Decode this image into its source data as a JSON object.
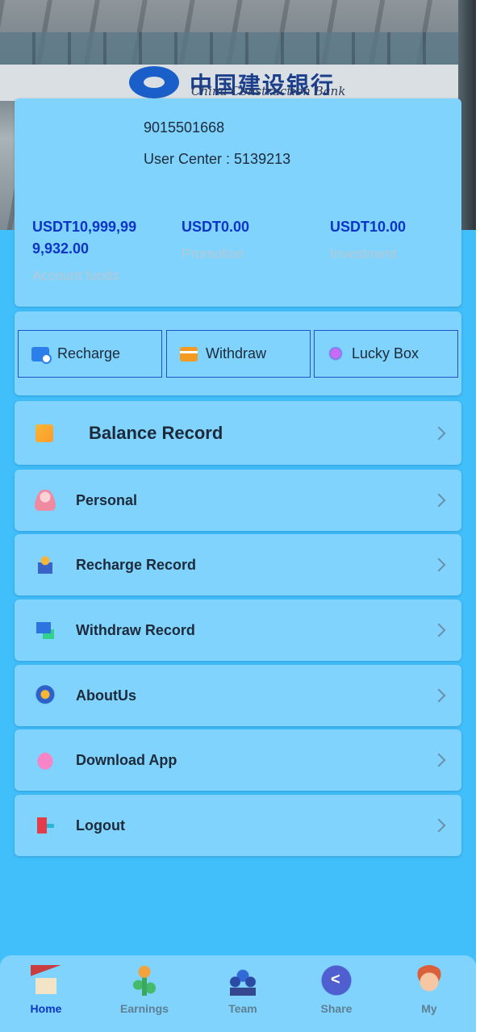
{
  "hero": {
    "bank_name_cn": "中国建设银行",
    "bank_name_en": "China Construction Bank"
  },
  "user": {
    "phone": "9015501668",
    "user_center": "User Center : 5139213"
  },
  "stats": [
    {
      "value": "USDT10,999,999,932.00",
      "label": "Account funds"
    },
    {
      "value": "USDT0.00",
      "label": "Promotion"
    },
    {
      "value": "USDT10.00",
      "label": "Investment"
    }
  ],
  "actions": [
    {
      "label": "Recharge",
      "icon": "wallet-icon"
    },
    {
      "label": "Withdraw",
      "icon": "card-icon"
    },
    {
      "label": "Lucky Box",
      "icon": "gem-icon"
    }
  ],
  "menu": {
    "balance_record": "Balance Record",
    "items": [
      {
        "label": "Personal",
        "icon": "person-icon"
      },
      {
        "label": "Recharge Record",
        "icon": "recharge-record-icon"
      },
      {
        "label": "Withdraw Record",
        "icon": "withdraw-record-icon"
      },
      {
        "label": "AboutUs",
        "icon": "about-icon"
      },
      {
        "label": "Download App",
        "icon": "android-icon"
      },
      {
        "label": "Logout",
        "icon": "logout-icon"
      }
    ]
  },
  "nav": [
    {
      "label": "Home",
      "icon": "home-icon",
      "active": true
    },
    {
      "label": "Earnings",
      "icon": "earnings-icon",
      "active": false
    },
    {
      "label": "Team",
      "icon": "team-icon",
      "active": false
    },
    {
      "label": "Share",
      "icon": "share-icon",
      "active": false
    },
    {
      "label": "My",
      "icon": "avatar-icon",
      "active": false
    }
  ],
  "colors": {
    "page_bg": "#41bffb",
    "card_bg": "#7fd3fd",
    "accent": "#0c35c8",
    "button_border": "#1e52c6"
  }
}
